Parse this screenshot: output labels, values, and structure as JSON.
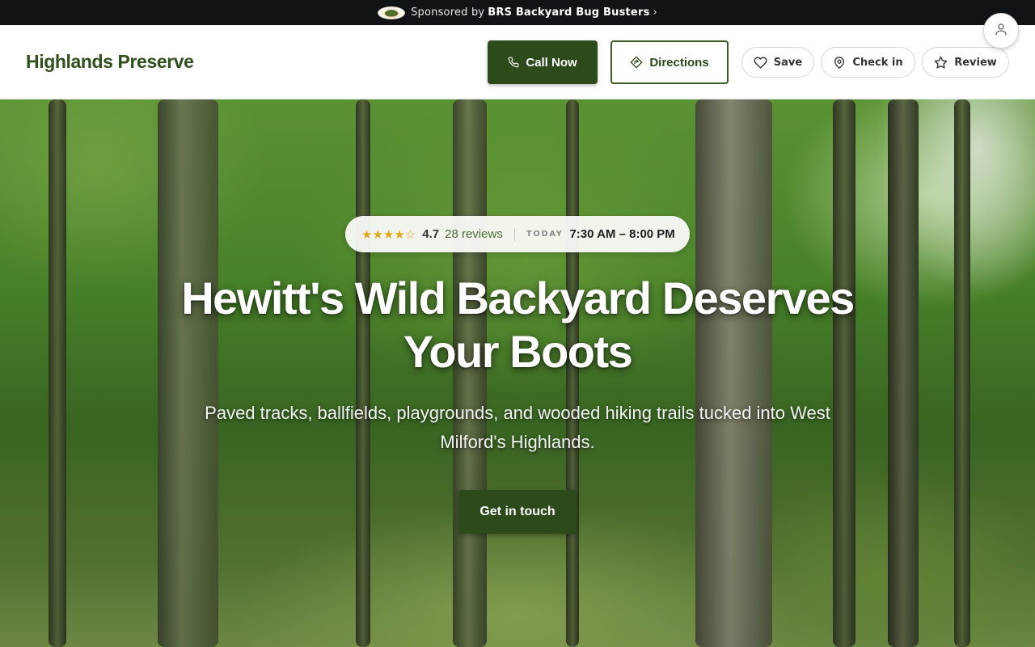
{
  "sponsor": {
    "prefix": "Sponsored by",
    "name": "BRS Backyard Bug Busters",
    "chevron": "›",
    "logo_icon": "brs-bug-busters-logo"
  },
  "header": {
    "brand": "Highlands Preserve",
    "call_label": "Call Now",
    "directions_label": "Directions",
    "save_label": "Save",
    "checkin_label": "Check in",
    "review_label": "Review",
    "icons": [
      "phone-icon",
      "directions-icon",
      "heart-icon",
      "location-pin-icon",
      "star-icon",
      "user-icon"
    ]
  },
  "hero": {
    "stars": "★★★★☆",
    "rating": "4.7",
    "reviews": "28 reviews",
    "today_label": "TODAY",
    "hours": "7:30 AM – 8:00 PM",
    "headline_line1": "Hewitt's Wild Backyard Deserves",
    "headline_line2": "Your Boots",
    "subline_line1": "Paved tracks, ballfields, playgrounds, and wooded hiking trails tucked into West",
    "subline_line2": "Milford's Highlands.",
    "cta_label": "Get in touch"
  },
  "colors": {
    "brand_green": "#2d4a1a",
    "sponsor_bar": "#111416",
    "star": "#e0a81c"
  }
}
